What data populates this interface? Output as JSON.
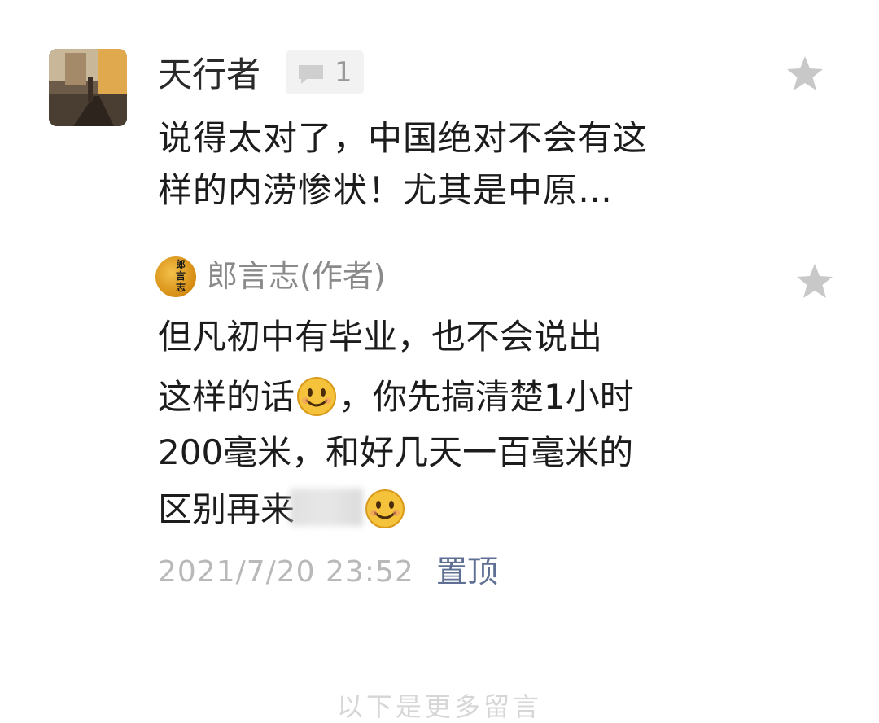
{
  "comment": {
    "username": "天行者",
    "reply_count": "1",
    "text_lines": [
      "说得太对了，中国绝对不会有这",
      "样的内涝惨状！尤其是中原…"
    ]
  },
  "reply": {
    "author_avatar_text": "郎言志",
    "author_name": "郎言志(作者)",
    "line1": "但凡初中有毕业，也不会说出",
    "line2_a": "这样的话",
    "line2_b": "，你先搞清楚1小时",
    "line3": "200毫米，和好几天一百毫米的",
    "line4_a": "区别再来",
    "timestamp": "2021/7/20 23:52",
    "pin_label": "置顶"
  },
  "footer": {
    "text": "以下是更多留言"
  },
  "icons": {
    "reply_icon": "comment-bubble-icon",
    "star_icon": "star-icon",
    "emoji_icon": "smile-emoji-icon"
  },
  "colors": {
    "text": "#1c1c1c",
    "muted": "#9a9a9a",
    "link": "#5e6f93",
    "star": "#c8c8c8",
    "emoji": "#f5c33b"
  }
}
